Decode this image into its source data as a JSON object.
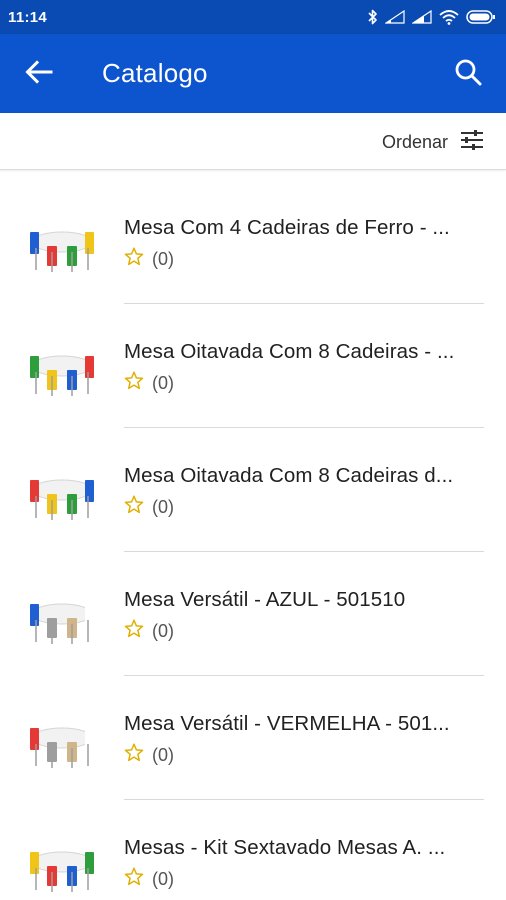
{
  "status_bar": {
    "time": "11:14",
    "icons": [
      "bluetooth-icon",
      "signal-icon",
      "signal-icon",
      "wifi-icon",
      "battery-icon"
    ]
  },
  "app_bar": {
    "title": "Catalogo",
    "back_icon": "arrow-left-icon",
    "search_icon": "search-icon",
    "background_color": "#0d55cf"
  },
  "sort_bar": {
    "label": "Ordenar",
    "icon": "sliders-icon"
  },
  "products": [
    {
      "name": "Mesa Com 4 Cadeiras de Ferro - ...",
      "rating_count": "(0)",
      "thumb_colors": [
        "#1f5fd1",
        "#e53935",
        "#2e9d3b",
        "#f0c419"
      ]
    },
    {
      "name": "Mesa Oitavada Com 8 Cadeiras - ...",
      "rating_count": "(0)",
      "thumb_colors": [
        "#2e9d3b",
        "#f0c419",
        "#1f5fd1",
        "#e53935"
      ]
    },
    {
      "name": "Mesa Oitavada Com 8 Cadeiras d...",
      "rating_count": "(0)",
      "thumb_colors": [
        "#e53935",
        "#f0c419",
        "#2e9d3b",
        "#1f5fd1"
      ]
    },
    {
      "name": "Mesa Versátil - AZUL - 501510",
      "rating_count": "(0)",
      "thumb_colors": [
        "#1f5fd1",
        "#9e9e9e",
        "#d0b48a",
        "#ffffff"
      ]
    },
    {
      "name": "Mesa Versátil - VERMELHA - 501...",
      "rating_count": "(0)",
      "thumb_colors": [
        "#e53935",
        "#9e9e9e",
        "#d0b48a",
        "#ffffff"
      ]
    },
    {
      "name": "Mesas - Kit Sextavado Mesas A. ...",
      "rating_count": "(0)",
      "thumb_colors": [
        "#f0c419",
        "#e53935",
        "#1f5fd1",
        "#2e9d3b"
      ]
    }
  ],
  "colors": {
    "accent": "#0d55cf",
    "status_bar": "#0a4bb3",
    "star": "#e0b000"
  }
}
